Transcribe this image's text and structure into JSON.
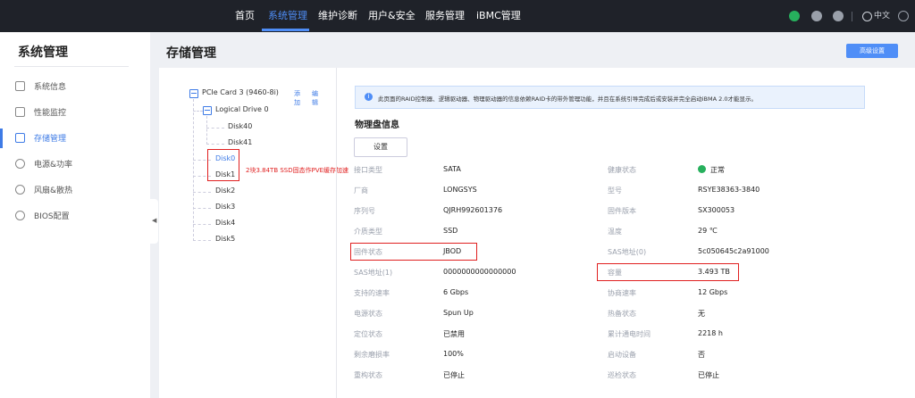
{
  "topnav": {
    "items": [
      "首页",
      "系统管理",
      "维护诊断",
      "用户&安全",
      "服务管理",
      "iBMC管理"
    ],
    "active": "系统管理",
    "lang": "中文"
  },
  "sidebar": {
    "title": "系统管理",
    "items": [
      {
        "label": "系统信息",
        "icon": "list-icon"
      },
      {
        "label": "性能监控",
        "icon": "chart-icon"
      },
      {
        "label": "存储管理",
        "icon": "storage-icon"
      },
      {
        "label": "电源&功率",
        "icon": "power-icon"
      },
      {
        "label": "风扇&散热",
        "icon": "fan-icon"
      },
      {
        "label": "BIOS配置",
        "icon": "gear-icon"
      }
    ],
    "active": "存储管理"
  },
  "page": {
    "title": "存储管理",
    "advanced_button": "高级设置"
  },
  "tree": {
    "controller": "PCIe Card 3 (9460-8i)",
    "add": "添加",
    "edit": "编辑",
    "logical_drive": "Logical Drive 0",
    "ld_disks": [
      "Disk40",
      "Disk41"
    ],
    "disks": [
      "Disk0",
      "Disk1",
      "Disk2",
      "Disk3",
      "Disk4",
      "Disk5"
    ],
    "annotation": "2块3.84TB SSD固态作PVE缓存加速"
  },
  "info_text": "此页面的RAID控制器、逻辑驱动器、物理驱动器的信息依赖RAID卡的带外管理功能，并且在系统引导完成后或安装并完全启动iBMA 2.0才能显示。",
  "section_title": "物理盘信息",
  "settings_button": "设置",
  "details_left": [
    {
      "label": "接口类型",
      "value": "SATA"
    },
    {
      "label": "厂商",
      "value": "LONGSYS"
    },
    {
      "label": "序列号",
      "value": "QJRH992601376"
    },
    {
      "label": "介质类型",
      "value": "SSD"
    },
    {
      "label": "固件状态",
      "value": "JBOD"
    },
    {
      "label": "SAS地址(1)",
      "value": "0000000000000000"
    },
    {
      "label": "支持的速率",
      "value": "6 Gbps"
    },
    {
      "label": "电源状态",
      "value": "Spun Up"
    },
    {
      "label": "定位状态",
      "value": "已禁用"
    },
    {
      "label": "剩余磨损率",
      "value": "100%"
    },
    {
      "label": "重构状态",
      "value": "已停止"
    }
  ],
  "details_right": [
    {
      "label": "健康状态",
      "value": "正常"
    },
    {
      "label": "型号",
      "value": "RSYE38363-3840"
    },
    {
      "label": "固件版本",
      "value": "SX300053"
    },
    {
      "label": "温度",
      "value": "29 ℃"
    },
    {
      "label": "SAS地址(0)",
      "value": "5c050645c2a91000"
    },
    {
      "label": "容量",
      "value": "3.493 TB"
    },
    {
      "label": "协商速率",
      "value": "12 Gbps"
    },
    {
      "label": "热备状态",
      "value": "无"
    },
    {
      "label": "累计通电时间",
      "value": "2218 h"
    },
    {
      "label": "启动设备",
      "value": "否"
    },
    {
      "label": "巡检状态",
      "value": "已停止"
    }
  ]
}
